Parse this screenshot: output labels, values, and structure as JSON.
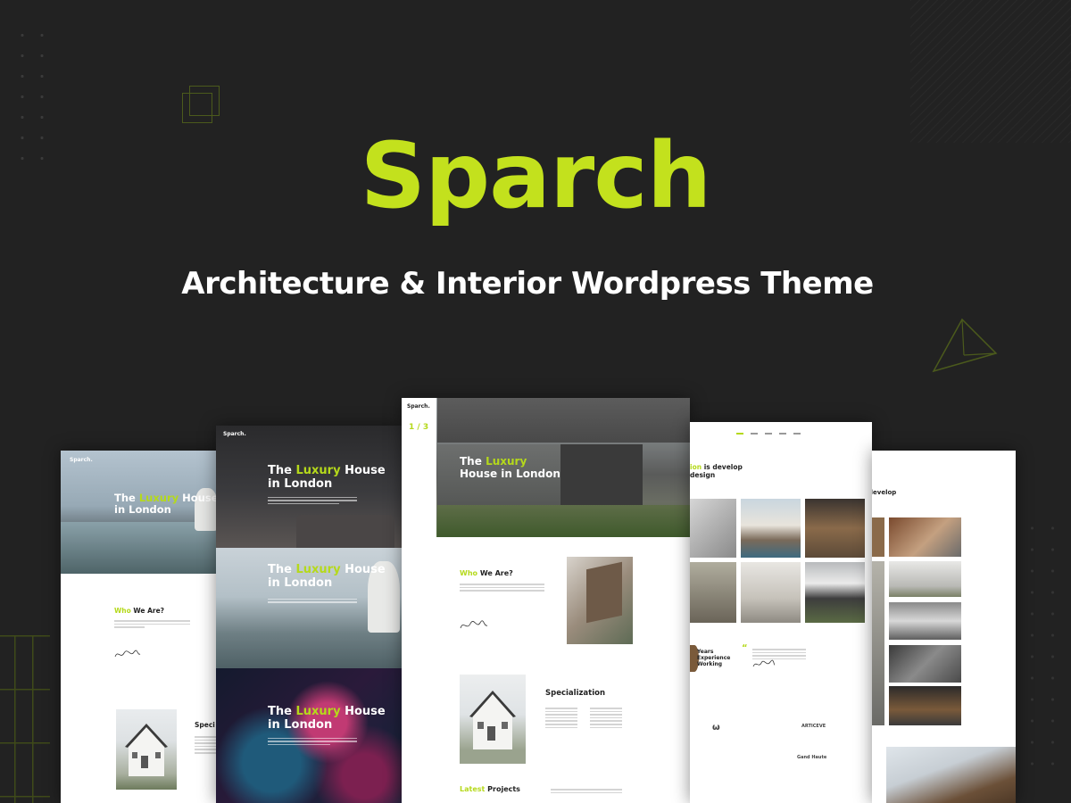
{
  "brand": {
    "name": "Sparch",
    "tagline": "Architecture & Interior Wordpress Theme",
    "accent_color": "#c3e11d",
    "background_color": "#222222"
  },
  "hero": {
    "line1_pre": "The",
    "line1_accent": "Luxury",
    "line1_post": "House",
    "line2": "in London",
    "line1_center_pre": "The",
    "line1_center_accent": "Luxury",
    "line2_center": "House in London"
  },
  "sections": {
    "who_pre": "Who",
    "who_post": "We Are?",
    "specialization": "Specialization",
    "specialization_short": "Speci",
    "latest_accent": "Latest",
    "latest_post": "Projects",
    "is_develop_pre": "ion",
    "is_develop_post": "is develop",
    "design": "design",
    "develop": "develop",
    "experience": "Years Experience Working",
    "experience_l1": "Years",
    "experience_l2": "Experience",
    "experience_l3": "Working"
  },
  "slider": {
    "pager": "1 / 3"
  },
  "logo": {
    "small": "Sparch."
  },
  "client_logos": {
    "l1": "ARTICEVE",
    "l2": "Gand Haute"
  },
  "icons": {
    "deco_squares": "square-outline-icon",
    "deco_triangle": "triangle-outline-icon",
    "quote": "quote-icon",
    "signature": "signature-icon"
  }
}
